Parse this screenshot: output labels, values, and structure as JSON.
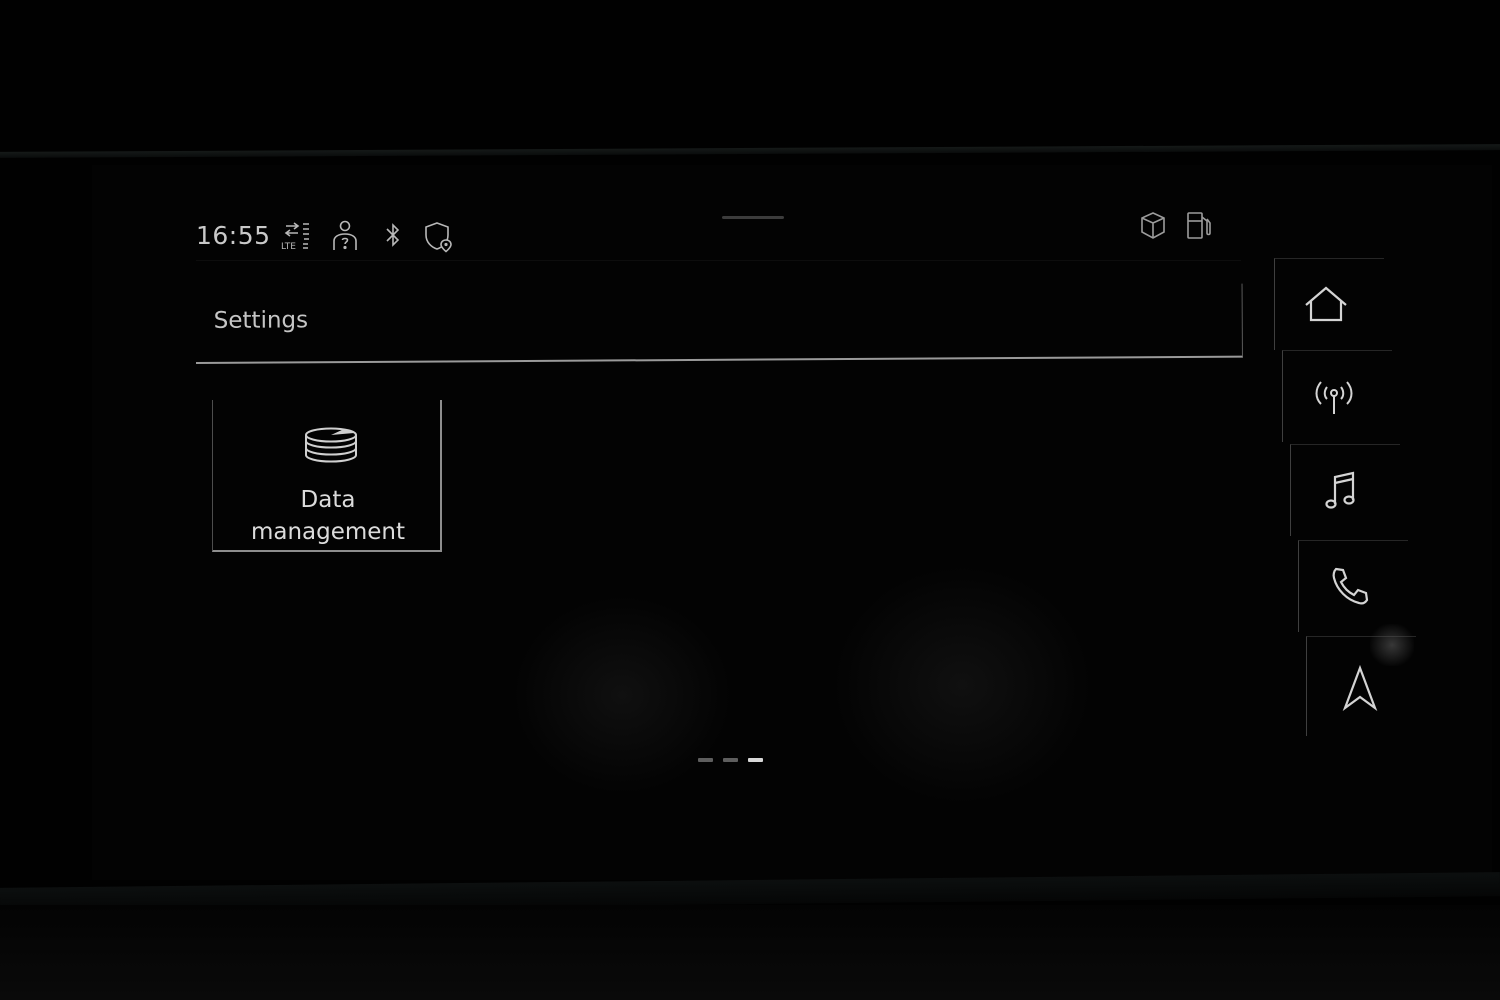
{
  "status_bar": {
    "time": "16:55",
    "left_icons": [
      "lte-signal-icon",
      "user-profile-icon",
      "bluetooth-icon",
      "privacy-location-icon"
    ],
    "right_icons": [
      "car-box-icon",
      "fuel-pump-icon"
    ]
  },
  "header": {
    "title": "Settings"
  },
  "tiles": [
    {
      "icon": "database-icon",
      "label_line1": "Data",
      "label_line2": "management"
    }
  ],
  "nav": [
    {
      "icon": "home-icon",
      "label": "Home"
    },
    {
      "icon": "radio-icon",
      "label": "Radio"
    },
    {
      "icon": "music-icon",
      "label": "Media"
    },
    {
      "icon": "phone-icon",
      "label": "Phone"
    },
    {
      "icon": "navigation-icon",
      "label": "Navigation"
    }
  ],
  "pager": {
    "page_count": 3,
    "current_page": 3
  },
  "colors": {
    "text_primary": "#dcdcdc",
    "text_secondary": "#c6c6c6",
    "background": "#030303",
    "divider": "#9a9a9a"
  }
}
